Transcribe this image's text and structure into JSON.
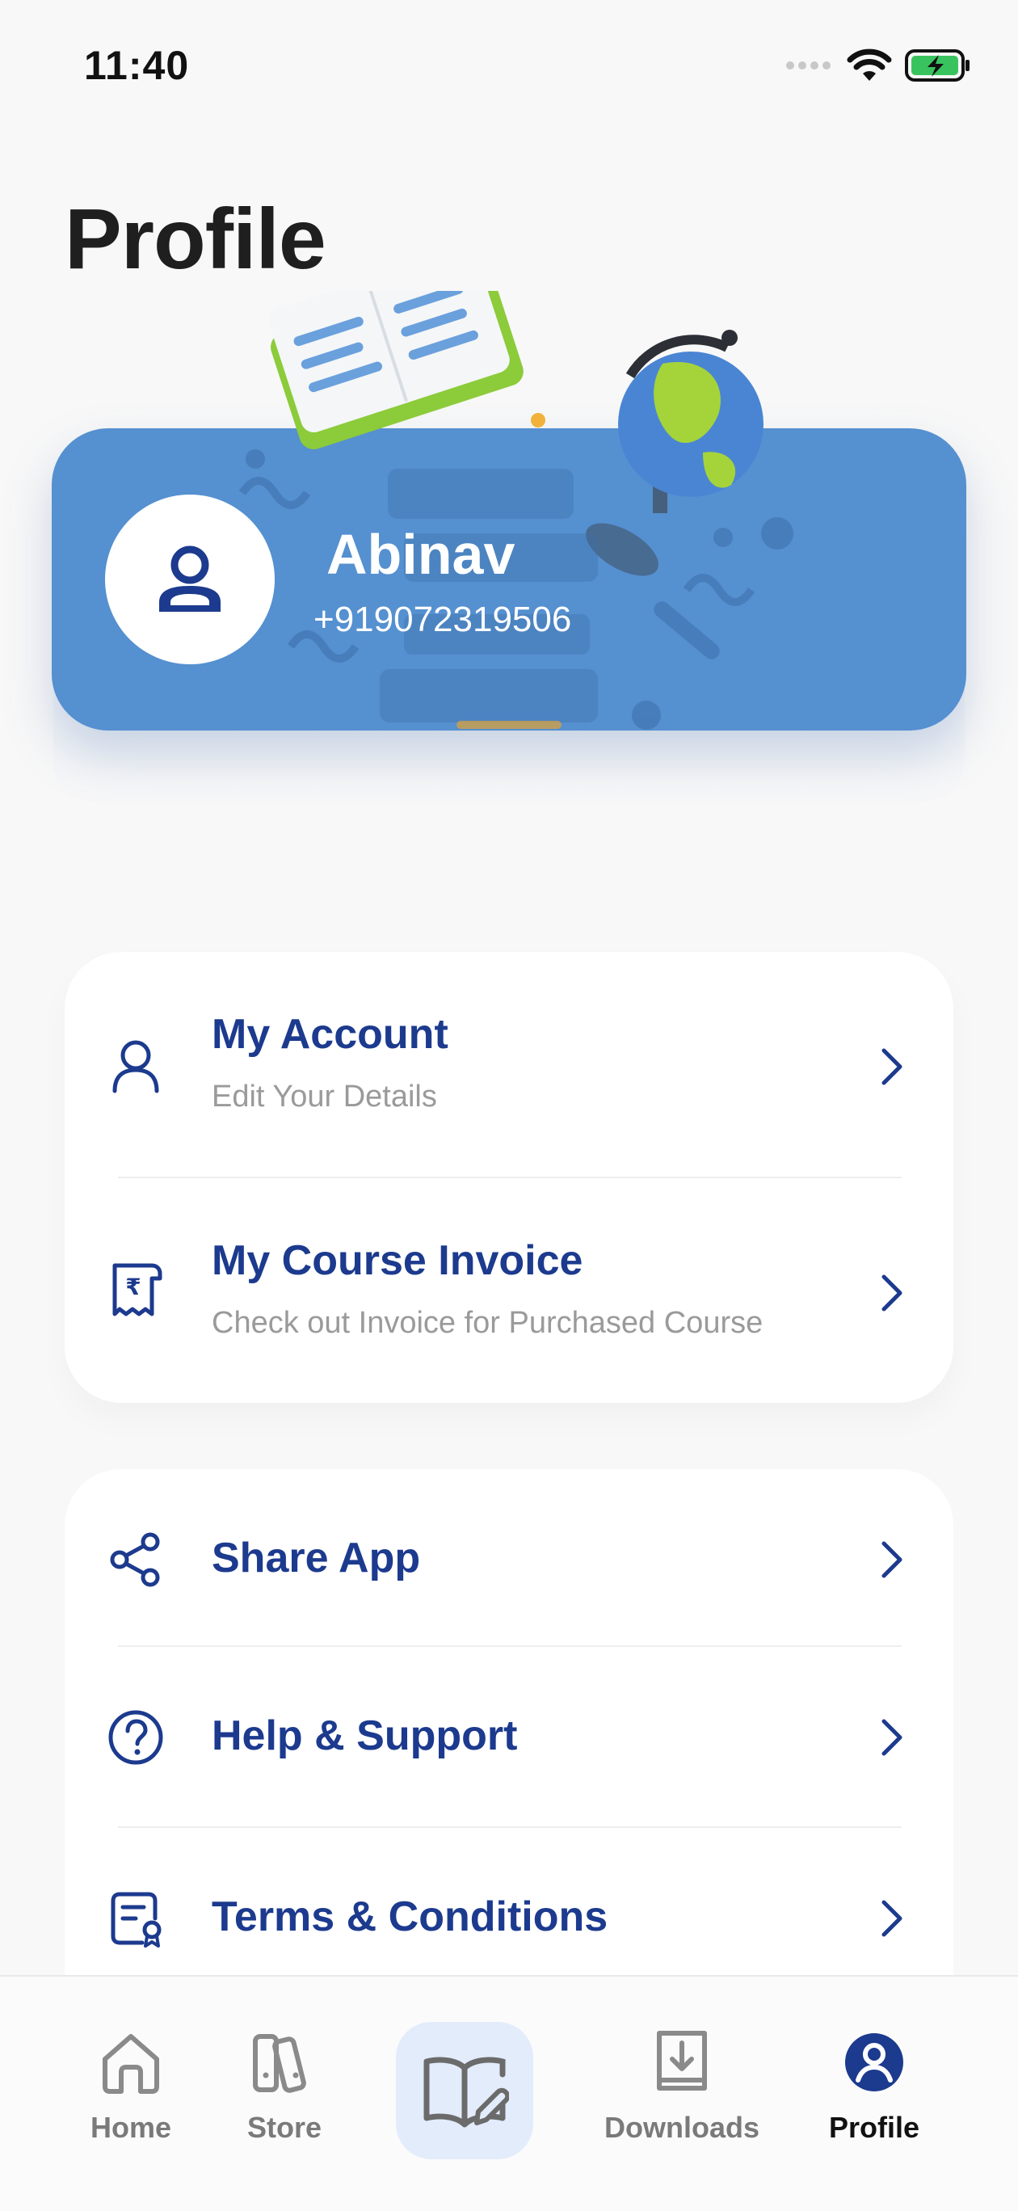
{
  "status_bar": {
    "time": "11:40"
  },
  "page": {
    "title": "Profile"
  },
  "profile": {
    "name": "Abinav",
    "phone": "+919072319506"
  },
  "account_menu": [
    {
      "title": "My Account",
      "subtitle": "Edit Your Details",
      "icon": "user-icon"
    },
    {
      "title": "My Course Invoice",
      "subtitle": "Check out Invoice for Purchased Course",
      "icon": "invoice-rupee-icon"
    }
  ],
  "app_menu": [
    {
      "title": "Share App",
      "icon": "share-icon"
    },
    {
      "title": "Help & Support",
      "icon": "help-circle-icon"
    },
    {
      "title": "Terms & Conditions",
      "icon": "terms-document-icon"
    }
  ],
  "bottom_nav": {
    "home": "Home",
    "store": "Store",
    "downloads": "Downloads",
    "profile": "Profile",
    "active": "profile"
  },
  "colors": {
    "accent": "#1c3a8e",
    "banner": "#5590d0",
    "center_button_bg": "#e3ecfb"
  }
}
